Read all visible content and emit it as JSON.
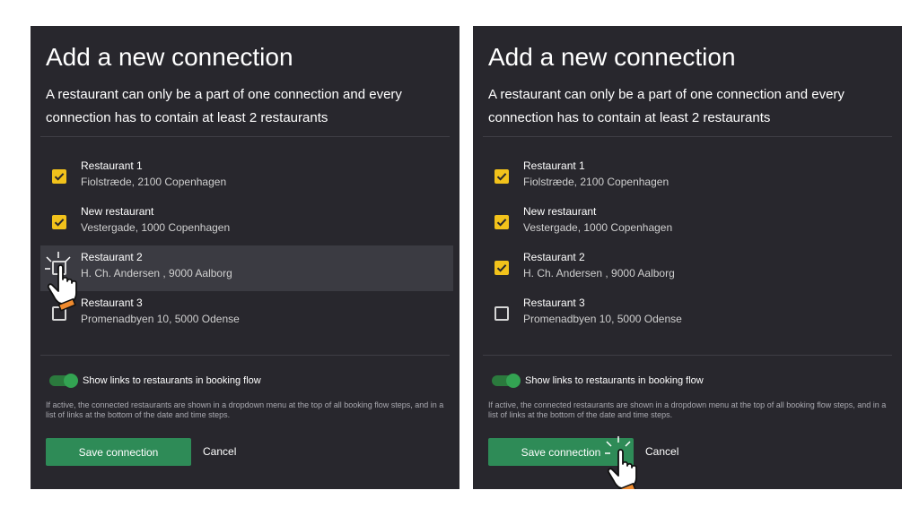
{
  "panels": [
    {
      "title": "Add a new connection",
      "subtitle": "A restaurant can only be a part of one connection and every connection has to contain at least 2 restaurants",
      "restaurants": [
        {
          "name": "Restaurant 1",
          "address": "Fiolstræde, 2100 Copenhagen",
          "checked": true
        },
        {
          "name": "New restaurant",
          "address": "Vestergade, 1000 Copenhagen",
          "checked": true
        },
        {
          "name": "Restaurant 2",
          "address": "H. Ch. Andersen , 9000 Aalborg",
          "checked": false,
          "hovered": true
        },
        {
          "name": "Restaurant 3",
          "address": "Promenadbyen 10, 5000 Odense",
          "checked": false
        }
      ],
      "toggle_label": "Show links to restaurants in booking flow",
      "toggle_on": true,
      "help_text": "If active, the connected restaurants are shown in a dropdown menu at the top of all booking flow steps, and in a list of links at the bottom of the date and time steps.",
      "save_label": "Save connection",
      "cancel_label": "Cancel"
    },
    {
      "title": "Add a new connection",
      "subtitle": "A restaurant can only be a part of one connection and every connection has to contain at least 2 restaurants",
      "restaurants": [
        {
          "name": "Restaurant 1",
          "address": "Fiolstræde, 2100 Copenhagen",
          "checked": true
        },
        {
          "name": "New restaurant",
          "address": "Vestergade, 1000 Copenhagen",
          "checked": true
        },
        {
          "name": "Restaurant 2",
          "address": "H. Ch. Andersen , 9000 Aalborg",
          "checked": true
        },
        {
          "name": "Restaurant 3",
          "address": "Promenadbyen 10, 5000 Odense",
          "checked": false
        }
      ],
      "toggle_label": "Show links to restaurants in booking flow",
      "toggle_on": true,
      "help_text": "If active, the connected restaurants are shown in a dropdown menu at the top of all booking flow steps, and in a list of links at the bottom of the date and time steps.",
      "save_label": "Save connection",
      "cancel_label": "Cancel"
    }
  ],
  "colors": {
    "background": "#28272d",
    "checkbox_checked": "#f2c21b",
    "toggle": "#33a352",
    "save_button": "#2e8b57",
    "hover_row": "#3b3b42"
  },
  "icons": [
    "checkmark-icon",
    "hand-cursor-icon"
  ]
}
